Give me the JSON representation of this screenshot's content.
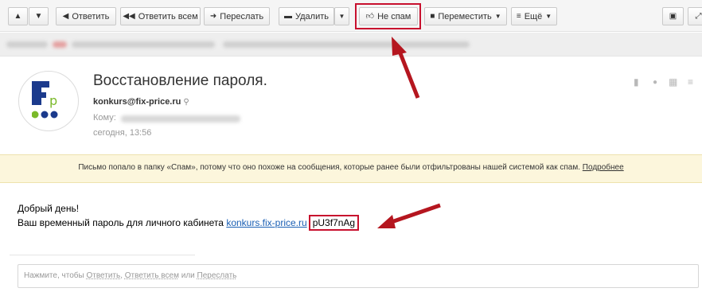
{
  "toolbar": {
    "reply_label": "Ответить",
    "reply_all_label": "Ответить всем",
    "forward_label": "Переслать",
    "delete_label": "Удалить",
    "not_spam_label": "Не спам",
    "move_label": "Переместить",
    "more_label": "Ещё"
  },
  "email": {
    "subject": "Восстановление пароля.",
    "sender": "konkurs@fix-price.ru",
    "to_label": "Кому:",
    "date": "сегодня, 13:56"
  },
  "notice": {
    "text": "Письмо попало в папку «Спам», потому что оно похоже на сообщения, которые ранее были отфильтрованы нашей системой как спам.",
    "more_link": "Подробнее"
  },
  "body": {
    "greeting": "Добрый день!",
    "line_prefix": "Ваш временный пароль для личного кабинета",
    "link_text": "konkurs.fix-price.ru",
    "password": "pU3f7nAg"
  },
  "reply": {
    "prefix": "Нажмите, чтобы",
    "reply": "Ответить",
    "comma": ",",
    "reply_all": "Ответить всем",
    "or": "или",
    "forward": "Переслать"
  },
  "colors": {
    "highlight": "#c8102e",
    "notice_bg": "#fcf6dc",
    "link": "#1a5fb4",
    "logo_blue": "#1b3a8c",
    "logo_green": "#7ab929"
  },
  "icons": [
    "up-icon",
    "down-icon",
    "reply-icon",
    "reply-all-icon",
    "forward-icon",
    "trash-icon",
    "thumbs-up-icon",
    "folder-icon",
    "menu-icon",
    "bookmark-icon",
    "dot-icon",
    "calendar-icon",
    "more-icon",
    "arrow-annotation"
  ]
}
